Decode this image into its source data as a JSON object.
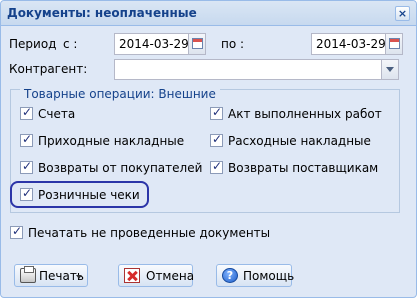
{
  "window": {
    "title": "Документы: неоплаченные",
    "close_glyph": "×"
  },
  "period": {
    "label": "Период",
    "from_label": "с :",
    "from_value": "2014-03-29",
    "to_label": "по :",
    "to_value": "2014-03-29"
  },
  "counterparty": {
    "label": "Контрагент:",
    "value": ""
  },
  "group": {
    "legend": "Товарные операции: Внешние",
    "items": [
      {
        "label": "Счета",
        "checked": true
      },
      {
        "label": "Акт выполненных работ",
        "checked": true
      },
      {
        "label": "Приходные накладные",
        "checked": true
      },
      {
        "label": "Расходные накладные",
        "checked": true
      },
      {
        "label": "Возвраты от покупателей",
        "checked": true
      },
      {
        "label": "Возвраты поставщикам",
        "checked": true
      },
      {
        "label": "Розничные чеки",
        "checked": true,
        "highlighted": true
      }
    ]
  },
  "print_unposted": {
    "label": "Печатать не проведенные документы",
    "checked": true
  },
  "buttons": {
    "print_label": "Печать",
    "cancel_label": "Отмена",
    "help_label": "Помощь",
    "help_glyph": "?"
  },
  "colors": {
    "title_text": "#15428b",
    "window_bg": "#dfe8f6",
    "highlight_outline": "#2b35a8"
  }
}
